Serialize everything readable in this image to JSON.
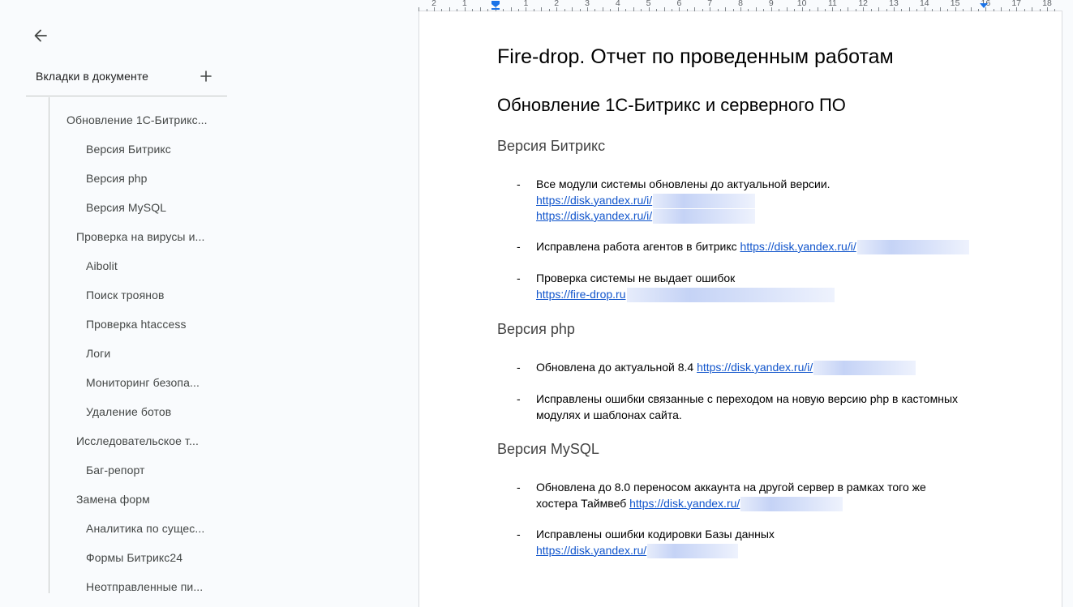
{
  "sidebar": {
    "title": "Вкладки в документе",
    "outline": [
      {
        "label": "Обновление 1С-Битрикс...",
        "level": 1
      },
      {
        "label": "Версия Битрикс",
        "level": 3
      },
      {
        "label": "Версия php",
        "level": 3
      },
      {
        "label": "Версия MySQL",
        "level": 3
      },
      {
        "label": "Проверка на вирусы и...",
        "level": 2
      },
      {
        "label": "Aibolit",
        "level": 3
      },
      {
        "label": "Поиск троянов",
        "level": 3
      },
      {
        "label": "Проверка htaccess",
        "level": 3
      },
      {
        "label": "Логи",
        "level": 3
      },
      {
        "label": "Мониторинг безопа...",
        "level": 3
      },
      {
        "label": "Удаление ботов",
        "level": 3
      },
      {
        "label": "Исследовательское т...",
        "level": 2
      },
      {
        "label": "Баг-репорт",
        "level": 3
      },
      {
        "label": "Замена форм",
        "level": 2
      },
      {
        "label": "Аналитика по сущес...",
        "level": 3
      },
      {
        "label": "Формы Битрикс24",
        "level": 3
      },
      {
        "label": "Неотправленные пи...",
        "level": 3
      }
    ]
  },
  "ruler": {
    "labels": [
      "2",
      "1",
      "1",
      "2",
      "3",
      "4",
      "5",
      "6",
      "7",
      "8",
      "9",
      "10",
      "11",
      "12",
      "13",
      "14",
      "15",
      "16",
      "17",
      "18"
    ]
  },
  "doc": {
    "title": "Fire-drop. Отчет по проведенным работам",
    "h1": "Обновление 1С-Битрикс и серверного ПО",
    "sections": {
      "bitrix": {
        "heading": "Версия Битрикс",
        "b1_text": "Все модули системы обновлены до актуальной версии.",
        "b1_link1": "https://disk.yandex.ru/i/",
        "b1_link2": "https://disk.yandex.ru/i/",
        "b2_text": "Исправлена работа агентов в битрикс ",
        "b2_link": "https://disk.yandex.ru/i/",
        "b3_text": "Проверка системы не выдает ошибок",
        "b3_link": "https://fire-drop.ru"
      },
      "php": {
        "heading": "Версия php",
        "b1_text": "Обновлена до актуальной 8.4 ",
        "b1_link": "https://disk.yandex.ru/i/",
        "b2_text": "Исправлены ошибки связанные с переходом на новую версию php в кастомных модулях и шаблонах сайта."
      },
      "mysql": {
        "heading": "Версия MySQL",
        "b1_text_line1": "Обновлена до 8.0 переносом аккаунта на другой сервер в рамках того же",
        "b1_text_line2": "хостера Таймвеб ",
        "b1_link": "https://disk.yandex.ru/",
        "b2_text": "Исправлены ошибки кодировки Базы данных",
        "b2_link": "https://disk.yandex.ru/"
      }
    },
    "bullet_char": "-"
  },
  "icons": {
    "back": "arrow-back-icon",
    "add": "plus-icon"
  },
  "colors": {
    "link": "#1155cc",
    "accent": "#1a73e8"
  }
}
